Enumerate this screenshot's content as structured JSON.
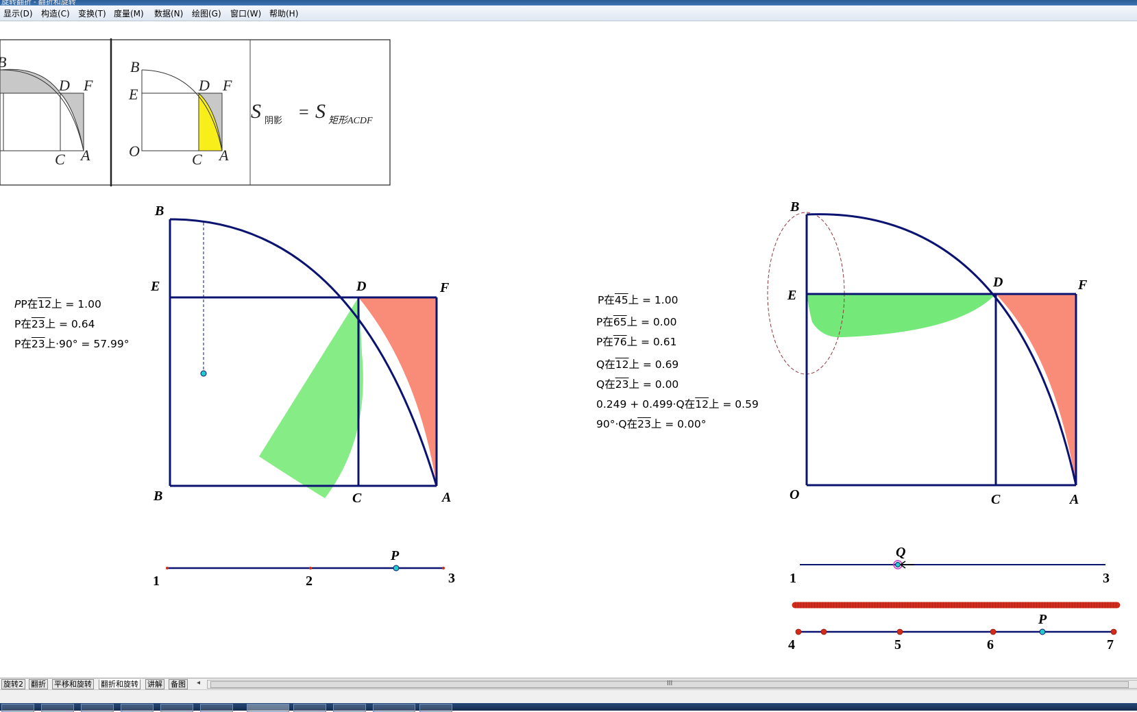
{
  "window": {
    "title": "旋转翻折 - 翻折和旋转"
  },
  "menu": [
    "显示(D)",
    "构造(C)",
    "变换(T)",
    "度量(M)",
    "数据(N)",
    "绘图(G)",
    "窗口(W)",
    "帮助(H)"
  ],
  "reference_image": {
    "panel1_labels": {
      "B": "B",
      "D": "D",
      "F": "F",
      "C": "C",
      "A": "A"
    },
    "panel2_labels": {
      "B": "B",
      "E": "E",
      "D": "D",
      "F": "F",
      "O": "O",
      "C": "C",
      "A": "A"
    },
    "formula": {
      "lhs": "S",
      "lhs_sub": "阴影",
      "eq": "=",
      "rhs": "S",
      "rhs_sub": "矩形ACDF"
    }
  },
  "left_figure": {
    "labels": {
      "B_top": "B",
      "E": "E",
      "D": "D",
      "F": "F",
      "B_bottom": "B",
      "C": "C",
      "A": "A"
    },
    "slider_labels": {
      "p1": "1",
      "p2": "2",
      "p3": "3",
      "P": "P"
    },
    "colors": {
      "outline": "#0b1370",
      "green": "#86ec86",
      "salmon": "#f98b79",
      "point": "#22cccc"
    },
    "measurements": [
      {
        "prefix": "P在",
        "seg": "12",
        "suffix": "上 = 1.00"
      },
      {
        "prefix": "P在",
        "seg": "23",
        "suffix": "上 = 0.64"
      },
      {
        "prefix": "P在",
        "seg": "23",
        "suffix": "上·90° = 57.99°"
      }
    ]
  },
  "right_figure": {
    "labels": {
      "B": "B",
      "E": "E",
      "D": "D",
      "F": "F",
      "O": "O",
      "C": "C",
      "A": "A"
    },
    "slider_Q_labels": {
      "p1": "1",
      "p3": "3",
      "Q": "Q"
    },
    "slider_P_labels": {
      "p4": "4",
      "p5": "5",
      "p6": "6",
      "p7": "7",
      "P": "P"
    },
    "colors": {
      "outline": "#0b1370",
      "green": "#74e878",
      "salmon": "#f98b79",
      "ellipse": "#8b3a3a",
      "red_bar": "#d42a1a"
    },
    "measurements": [
      {
        "prefix": "P在",
        "seg": "45",
        "suffix": "上 = 1.00"
      },
      {
        "prefix": "P在",
        "seg": "65",
        "suffix": "上 = 0.00"
      },
      {
        "prefix": "P在",
        "seg": "76",
        "suffix": "上 = 0.61"
      },
      {
        "prefix": "Q在",
        "seg": "12",
        "suffix": "上 = 0.69"
      },
      {
        "prefix": "Q在",
        "seg": "23",
        "suffix": "上 = 0.00"
      },
      {
        "prefix": "0.249 + 0.499·Q在",
        "seg": "12",
        "suffix": "上 = 0.59"
      },
      {
        "prefix": "90°·Q在",
        "seg": "23",
        "suffix": "上 = 0.00°"
      }
    ]
  },
  "tabs": [
    "旋转2",
    "翻折",
    "平移和旋转",
    "翻折和旋转",
    "讲解",
    "备图"
  ],
  "active_tab": "翻折和旋转",
  "scroll_grip": "III"
}
